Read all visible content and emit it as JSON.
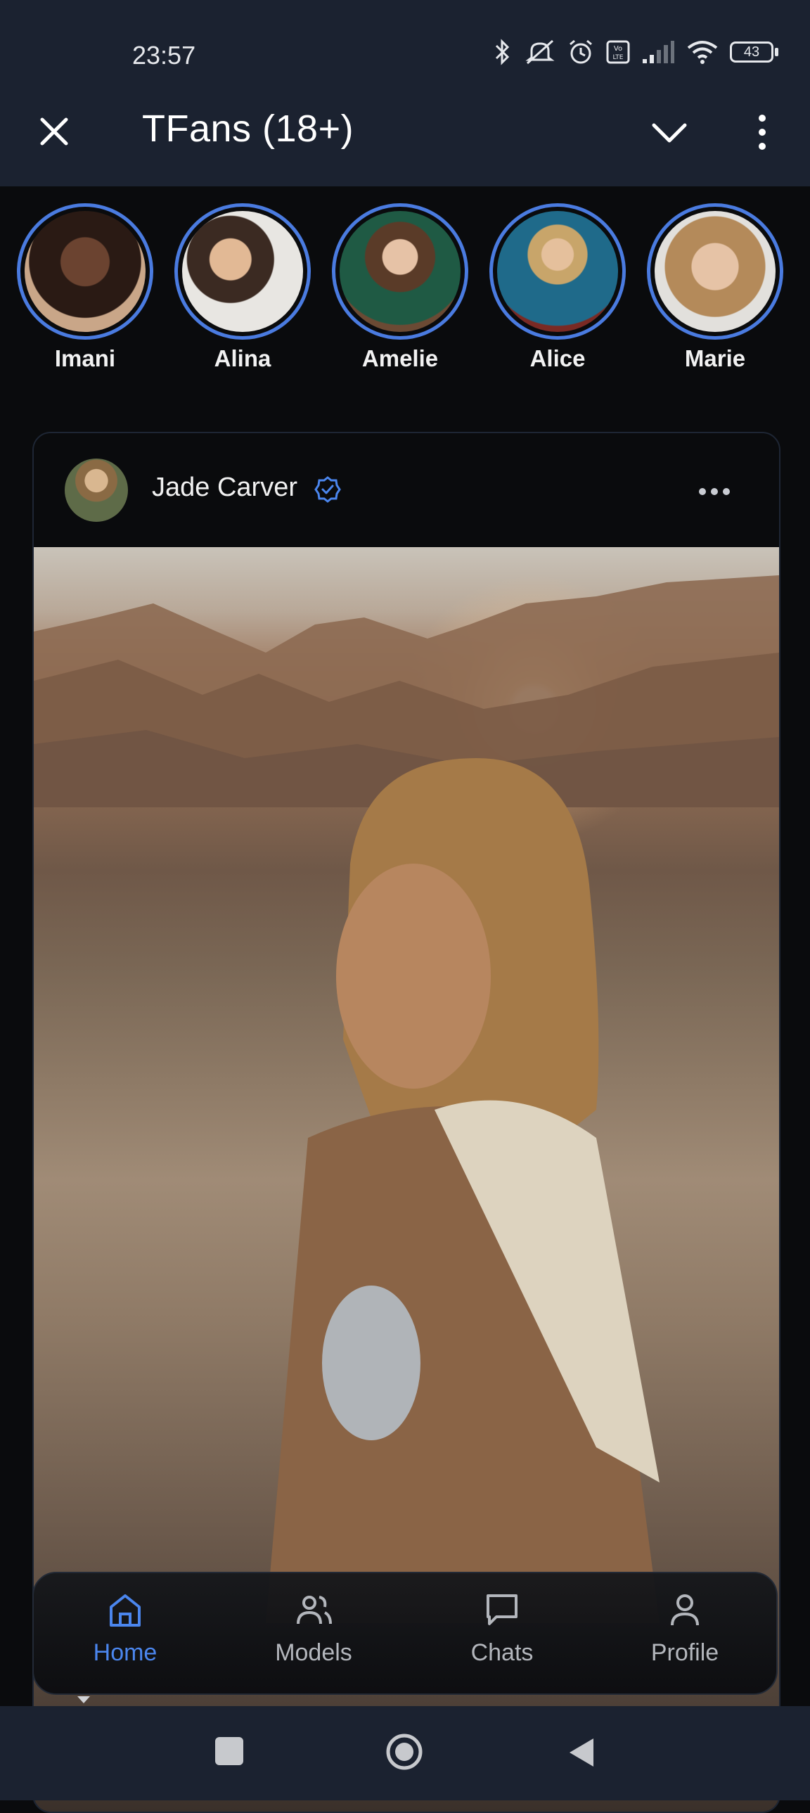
{
  "status_bar": {
    "time": "23:57",
    "battery": "43",
    "icons": [
      "bluetooth-icon",
      "mute-icon",
      "alarm-icon",
      "volte-icon",
      "signal-icon",
      "wifi-icon",
      "battery-icon"
    ]
  },
  "app_bar": {
    "title": "TFans (18+)",
    "icons": [
      "close-icon",
      "chevron-down-icon",
      "more-vert-icon"
    ]
  },
  "stories": [
    {
      "name": "Imani"
    },
    {
      "name": "Alina"
    },
    {
      "name": "Amelie"
    },
    {
      "name": "Alice"
    },
    {
      "name": "Marie"
    }
  ],
  "post": {
    "author": "Jade Carver",
    "verified": true,
    "more_icon": "more-horiz-icon"
  },
  "bottom_nav": {
    "items": [
      {
        "label": "Home",
        "icon": "home-icon",
        "active": true
      },
      {
        "label": "Models",
        "icon": "users-icon",
        "active": false
      },
      {
        "label": "Chats",
        "icon": "chat-icon",
        "active": false
      },
      {
        "label": "Profile",
        "icon": "person-icon",
        "active": false
      }
    ]
  },
  "colors": {
    "accent": "#4b86ee",
    "topbar": "#1b2230",
    "background": "#0a0b0d"
  }
}
